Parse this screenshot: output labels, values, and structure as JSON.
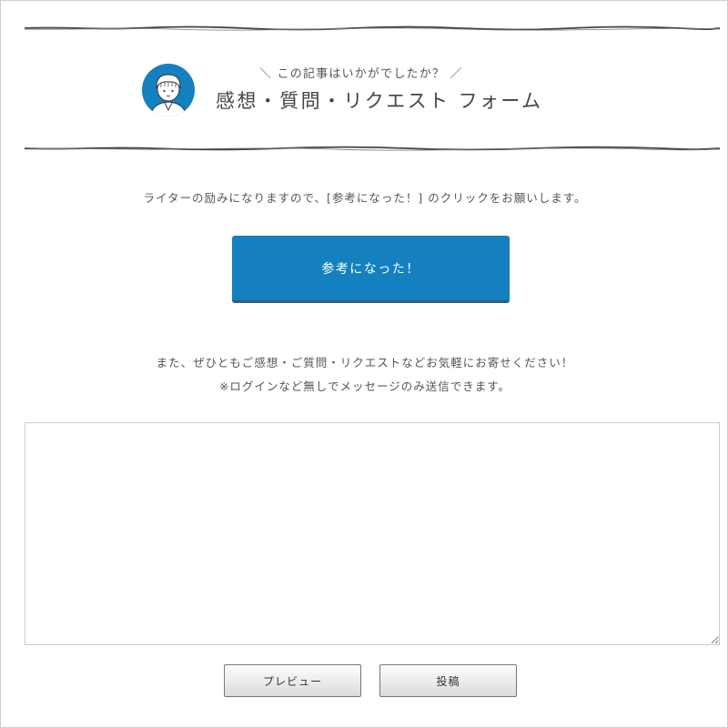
{
  "header": {
    "subtitle": "＼ この記事はいかがでしたか？ ／",
    "title": "感想・質問・リクエスト フォーム",
    "avatar_icon": "writer-avatar-icon",
    "avatar_color": "#1480c0"
  },
  "request": {
    "text": "ライターの励みになりますので、[参考になった！] のクリックをお願いします。",
    "helpful_button_label": "参考になった！",
    "button_color": "#1480c0"
  },
  "notes": {
    "line1": "また、ぜひともご感想・ご質問・リクエストなどお気軽にお寄せください！",
    "line2": "※ログインなど無しでメッセージのみ送信できます。"
  },
  "form": {
    "message_value": "",
    "preview_label": "プレビュー",
    "submit_label": "投稿"
  }
}
